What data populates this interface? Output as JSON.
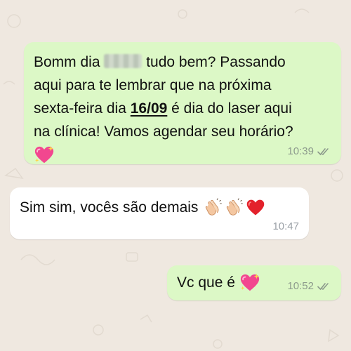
{
  "chat": {
    "messages": [
      {
        "direction": "outgoing",
        "part1": "Bomm dia",
        "part2": "tudo bem? Passando",
        "line2": "aqui para te lembrar que na próxima",
        "line3_prefix": "sexta-feira dia",
        "date": "16/09",
        "line3_suffix": "é dia do laser aqui",
        "line4": "na clínica! Vamos agendar seu horário?",
        "emoji": "sparkling-heart",
        "time": "10:39",
        "status": "read"
      },
      {
        "direction": "incoming",
        "text": "Sim sim, vocês são demais",
        "emojis": [
          "clapping-hands",
          "clapping-hands",
          "red-heart"
        ],
        "time": "10:47"
      },
      {
        "direction": "outgoing",
        "text": "Vc que é",
        "emoji": "sparkling-heart",
        "time": "10:52",
        "status": "read"
      }
    ]
  },
  "colors": {
    "outgoing_bubble": "#dcf8c6",
    "incoming_bubble": "#ffffff",
    "background": "#efe8e0",
    "meta_text": "#8c9a8c"
  }
}
